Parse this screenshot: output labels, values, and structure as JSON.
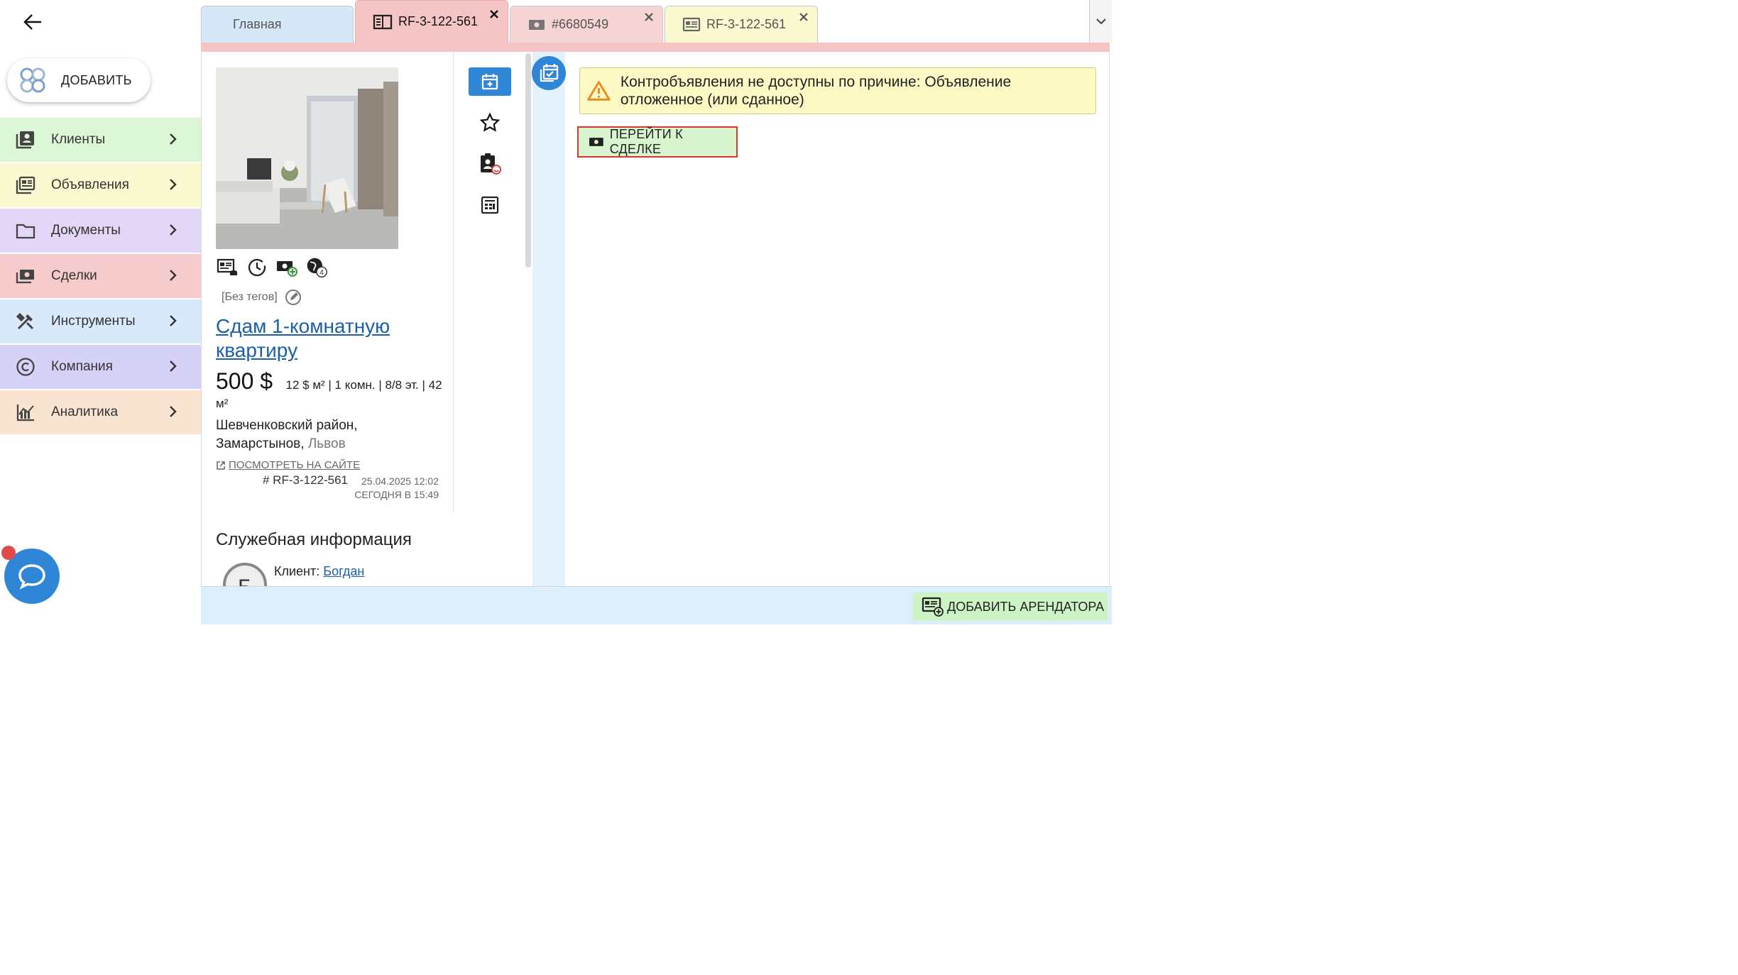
{
  "sidebar": {
    "add_label": "ДОБАВИТЬ",
    "items": [
      {
        "label": "Клиенты",
        "icon": "clients-icon",
        "color": "#dcf7d6"
      },
      {
        "label": "Объявления",
        "icon": "listings-icon",
        "color": "#fbf9cf"
      },
      {
        "label": "Документы",
        "icon": "folder-icon",
        "color": "#e3d6f7"
      },
      {
        "label": "Сделки",
        "icon": "deal-icon",
        "color": "#f6cbcb"
      },
      {
        "label": "Инструменты",
        "icon": "tools-icon",
        "color": "#d8e9fb"
      },
      {
        "label": "Компания",
        "icon": "copyright-icon",
        "color": "#d6d2f7"
      },
      {
        "label": "Аналитика",
        "icon": "analytics-icon",
        "color": "#f9e4d2"
      }
    ]
  },
  "tabs": [
    {
      "label": "Главная",
      "color": "#d6e7f7",
      "active": false,
      "closable": false
    },
    {
      "label": "RF-3-122-561",
      "color": "#f5c4c4",
      "active": true,
      "closable": true,
      "icon": "book-icon"
    },
    {
      "label": "#6680549",
      "color": "#f7d4d4",
      "active": false,
      "closable": true,
      "icon": "money-icon"
    },
    {
      "label": "RF-3-122-561",
      "color": "#fbf9cf",
      "active": false,
      "closable": true,
      "icon": "listing-icon"
    }
  ],
  "listing": {
    "no_tags": "[Без тегов]",
    "title": "Сдам 1-комнатную квартиру",
    "price": "500 $",
    "meta": "12 $ м² | 1 комн. | 8/8 эт. | 42 м²",
    "address_line1": "Шевченковский район,",
    "address_line2": "Замарстынов,",
    "city": "Львов",
    "view_site": "ПОСМОТРЕТЬ НА САЙТЕ",
    "ref": "# RF-3-122-561",
    "date_created": "25.04.2025 12:02",
    "date_updated": "СЕГОДНЯ В 15:49",
    "globe_badge": "4"
  },
  "warning": {
    "text": "Контробъявления не доступны по причине: Объявление отложенное (или сданное)"
  },
  "deal_button": "ПЕРЕЙТИ К СДЕЛКЕ",
  "service": {
    "title": "Служебная информация",
    "client_label": "Клиент:",
    "client_name": "Богдан",
    "avatar_letter": "Б"
  },
  "bottom": {
    "add_tenant": "ДОБАВИТЬ АРЕНДАТОРА"
  },
  "colors": {
    "accent_blue": "#2f86d6",
    "warning_bg": "#fcf9c4",
    "deal_button_border": "#e0362a"
  }
}
